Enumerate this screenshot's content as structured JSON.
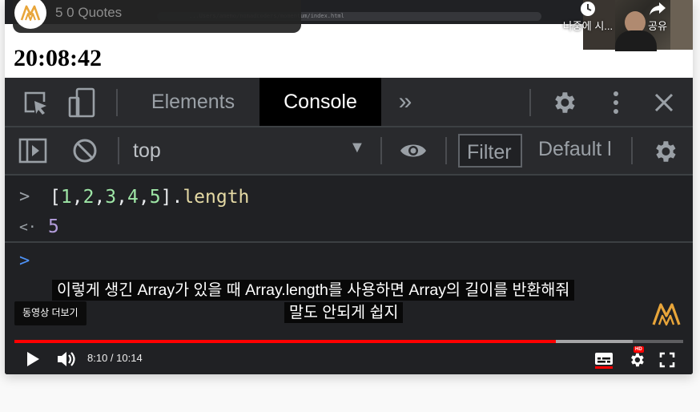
{
  "video": {
    "title": "5 0 Quotes",
    "watch_later_label": "나중에 시...",
    "share_label": "공유",
    "more_videos_label": "동영상 더보기",
    "time_display": "8:10 / 10:14",
    "progress_fraction": 0.81,
    "buffered_fraction": 0.925,
    "hd_badge": "HD",
    "subtitles": [
      "이렇게 생긴 Array가 있을 때 Array.length를 사용하면 Array의 길이를 반환해줘",
      "말도 안되게 쉽지"
    ]
  },
  "webpage": {
    "clock": "20:08:42",
    "url_text": "...Users/amemo/nomadcoders/momentum/index.html"
  },
  "devtools": {
    "tabs": [
      "Elements",
      "Console"
    ],
    "active_tab": "Console",
    "more_tabs_label": "»",
    "context": "top",
    "filter_placeholder": "Filter",
    "levels_label": "Default l",
    "console_lines": [
      {
        "type": "input",
        "prompt": ">",
        "tokens": [
          "[",
          "1",
          ",",
          "2",
          ",",
          "3",
          ",",
          "4",
          ",",
          "5",
          "]",
          ".",
          "length"
        ]
      },
      {
        "type": "result",
        "prompt": "<·",
        "value": "5"
      },
      {
        "type": "prompt",
        "prompt": ">"
      }
    ]
  },
  "colors": {
    "accent_red": "#ff0000",
    "devtools_bg": "#202124",
    "console_number": "#9ee6a6",
    "console_result": "#b39ddb",
    "prompt_blue": "#4e92f6",
    "brand_orange": "#e8a53a"
  }
}
